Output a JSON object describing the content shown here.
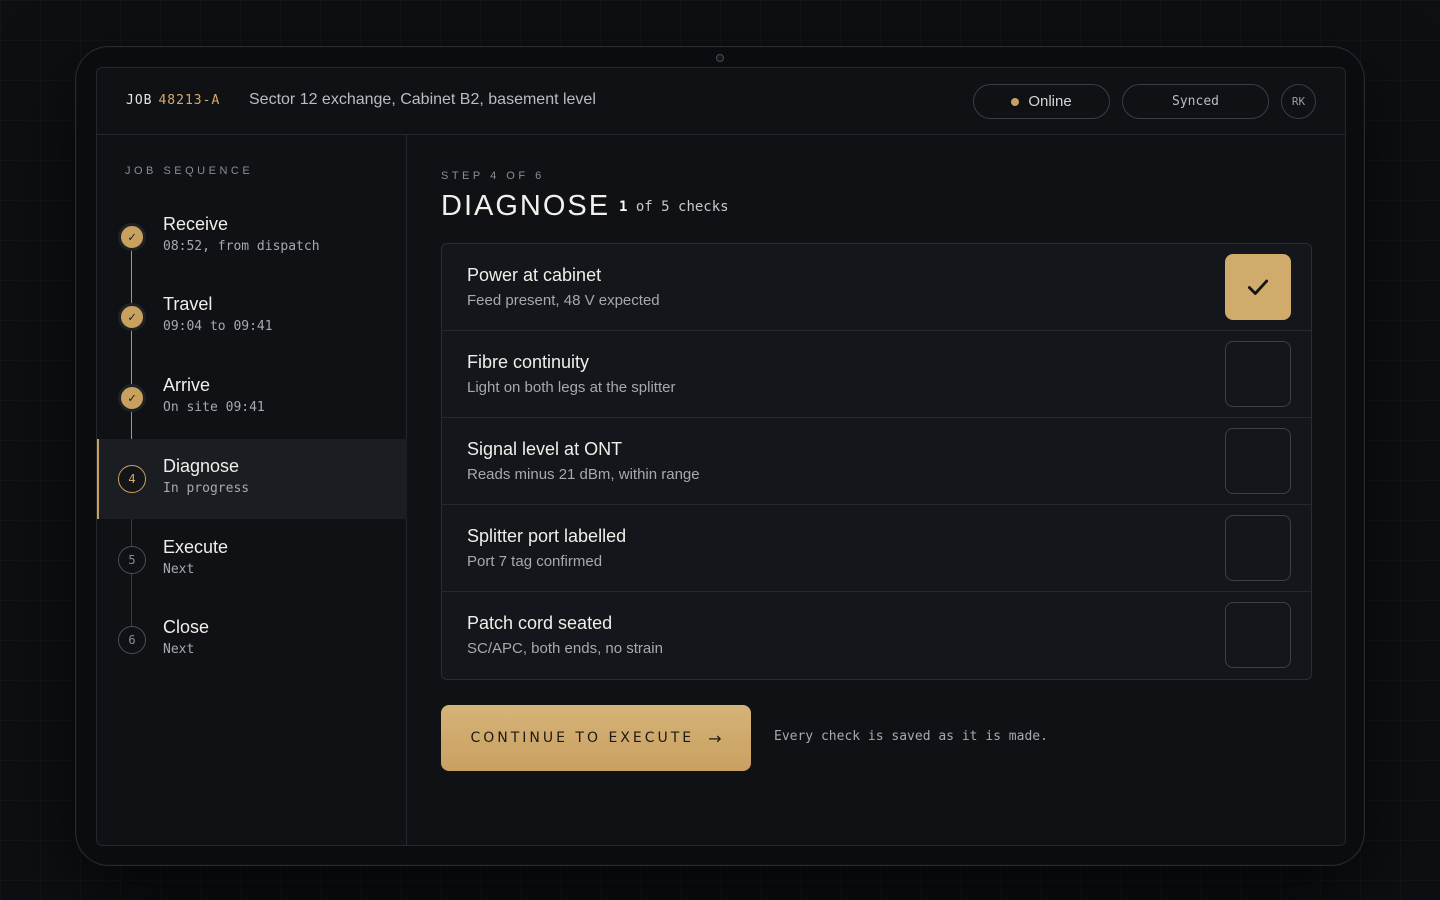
{
  "header": {
    "job_prefix": "JOB",
    "job_id": "48213-A",
    "location": "Sector 12 exchange, Cabinet B2, basement level",
    "status_online": "Online",
    "status_synced": "Synced",
    "user_initials": "RK"
  },
  "sidebar": {
    "title": "JOB SEQUENCE",
    "steps": [
      {
        "label": "Receive",
        "sub": "08:52, from dispatch",
        "state": "done",
        "icon": "check-icon"
      },
      {
        "label": "Travel",
        "sub": "09:04 to 09:41",
        "state": "done",
        "icon": "check-icon"
      },
      {
        "label": "Arrive",
        "sub": "On site 09:41",
        "state": "done",
        "icon": "check-icon"
      },
      {
        "label": "Diagnose",
        "sub": "In progress",
        "state": "current",
        "number": "4"
      },
      {
        "label": "Execute",
        "sub": "Next",
        "state": "next",
        "number": "5"
      },
      {
        "label": "Close",
        "sub": "Next",
        "state": "next",
        "number": "6"
      }
    ]
  },
  "main": {
    "step_of": "STEP 4 OF 6",
    "title": "DIAGNOSE",
    "count_done": "1",
    "count_text": "of 5 checks",
    "checks": [
      {
        "title": "Power at cabinet",
        "desc": "Feed present, 48 V expected",
        "checked": true
      },
      {
        "title": "Fibre continuity",
        "desc": "Light on both legs at the splitter",
        "checked": false
      },
      {
        "title": "Signal level at ONT",
        "desc": "Reads minus 21 dBm, within range",
        "checked": false
      },
      {
        "title": "Splitter port labelled",
        "desc": "Port 7 tag confirmed",
        "checked": false
      },
      {
        "title": "Patch cord seated",
        "desc": "SC/APC, both ends, no strain",
        "checked": false
      }
    ],
    "continue_label": "CONTINUE TO EXECUTE",
    "continue_arrow": "→",
    "save_note": "Every check is saved as it is made."
  },
  "colors": {
    "accent": "#c9a15e",
    "job_id": "#d7a96b",
    "background": "#0d0f12",
    "panel": "#13161a"
  }
}
